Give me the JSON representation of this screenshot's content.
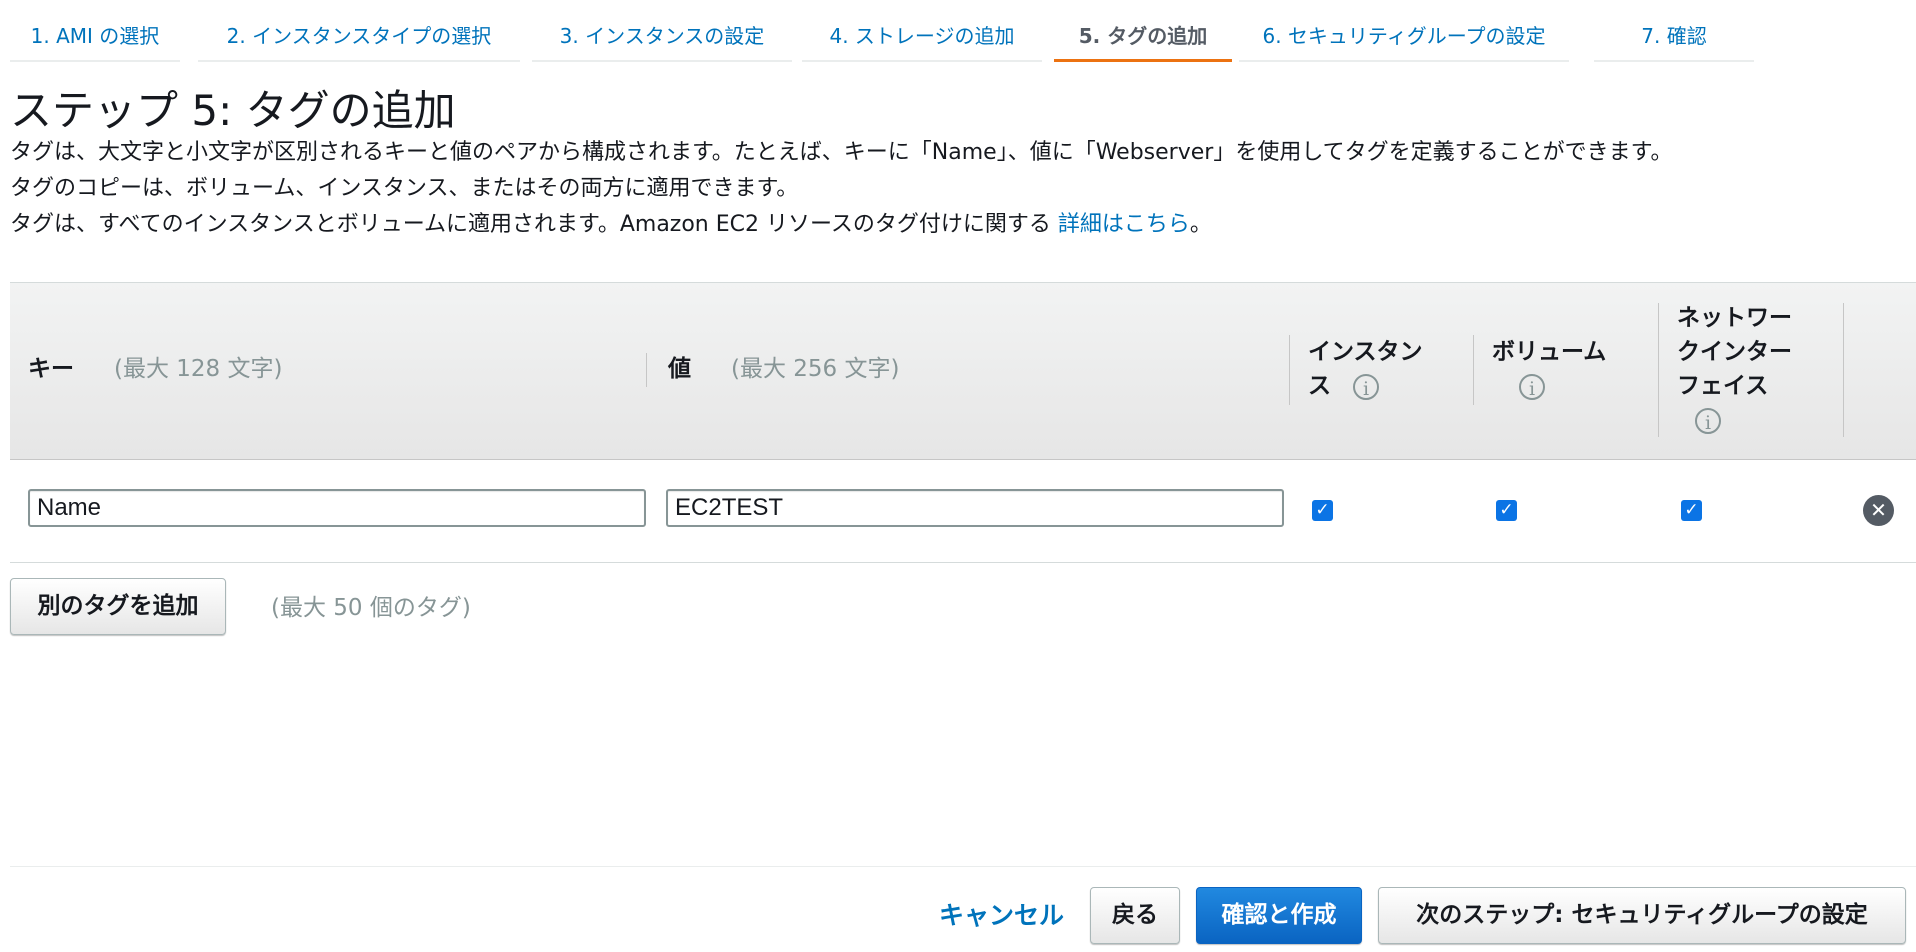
{
  "steps": [
    {
      "label": "1. AMI の選択"
    },
    {
      "label": "2. インスタンスタイプの選択"
    },
    {
      "label": "3. インスタンスの設定"
    },
    {
      "label": "4. ストレージの追加"
    },
    {
      "label": "5. タグの追加",
      "active": true
    },
    {
      "label": "6. セキュリティグループの設定"
    },
    {
      "label": "7. 確認"
    }
  ],
  "page": {
    "title": "ステップ 5: タグの追加",
    "desc_line1": "タグは、大文字と小文字が区別されるキーと値のペアから構成されます。たとえば、キーに「Name」、値に「Webserver」を使用してタグを定義することができます。",
    "desc_line2": "タグのコピーは、ボリューム、インスタンス、またはその両方に適用できます。",
    "desc_line3_prefix": "タグは、すべてのインスタンスとボリュームに適用されます。Amazon EC2 リソースのタグ付けに関する ",
    "desc_link": "詳細はこちら",
    "desc_line3_suffix": "。"
  },
  "table": {
    "headers": {
      "key": "キー",
      "key_hint": "(最大 128 文字)",
      "value": "値",
      "value_hint": "(最大 256 文字)",
      "instance_line1": "インスタン",
      "instance_line2": "ス",
      "volume": "ボリューム",
      "eni_line1": "ネットワー",
      "eni_line2": "クインター",
      "eni_line3": "フェイス"
    },
    "rows": [
      {
        "key": "Name",
        "value": "EC2TEST",
        "instance": true,
        "volume": true,
        "eni": true
      }
    ],
    "info_glyph": "i",
    "check_glyph": "✓",
    "remove_glyph": "✕"
  },
  "add_tag": {
    "button": "別のタグを追加",
    "hint": "(最大 50 個のタグ)"
  },
  "footer": {
    "cancel": "キャンセル",
    "back": "戻る",
    "review": "確認と作成",
    "next": "次のステップ: セキュリティグループの設定"
  },
  "colors": {
    "link": "#0073bb",
    "active_tab_underline": "#ec7211",
    "primary_button": "#0a64c2",
    "checkbox": "#0b74e5"
  }
}
